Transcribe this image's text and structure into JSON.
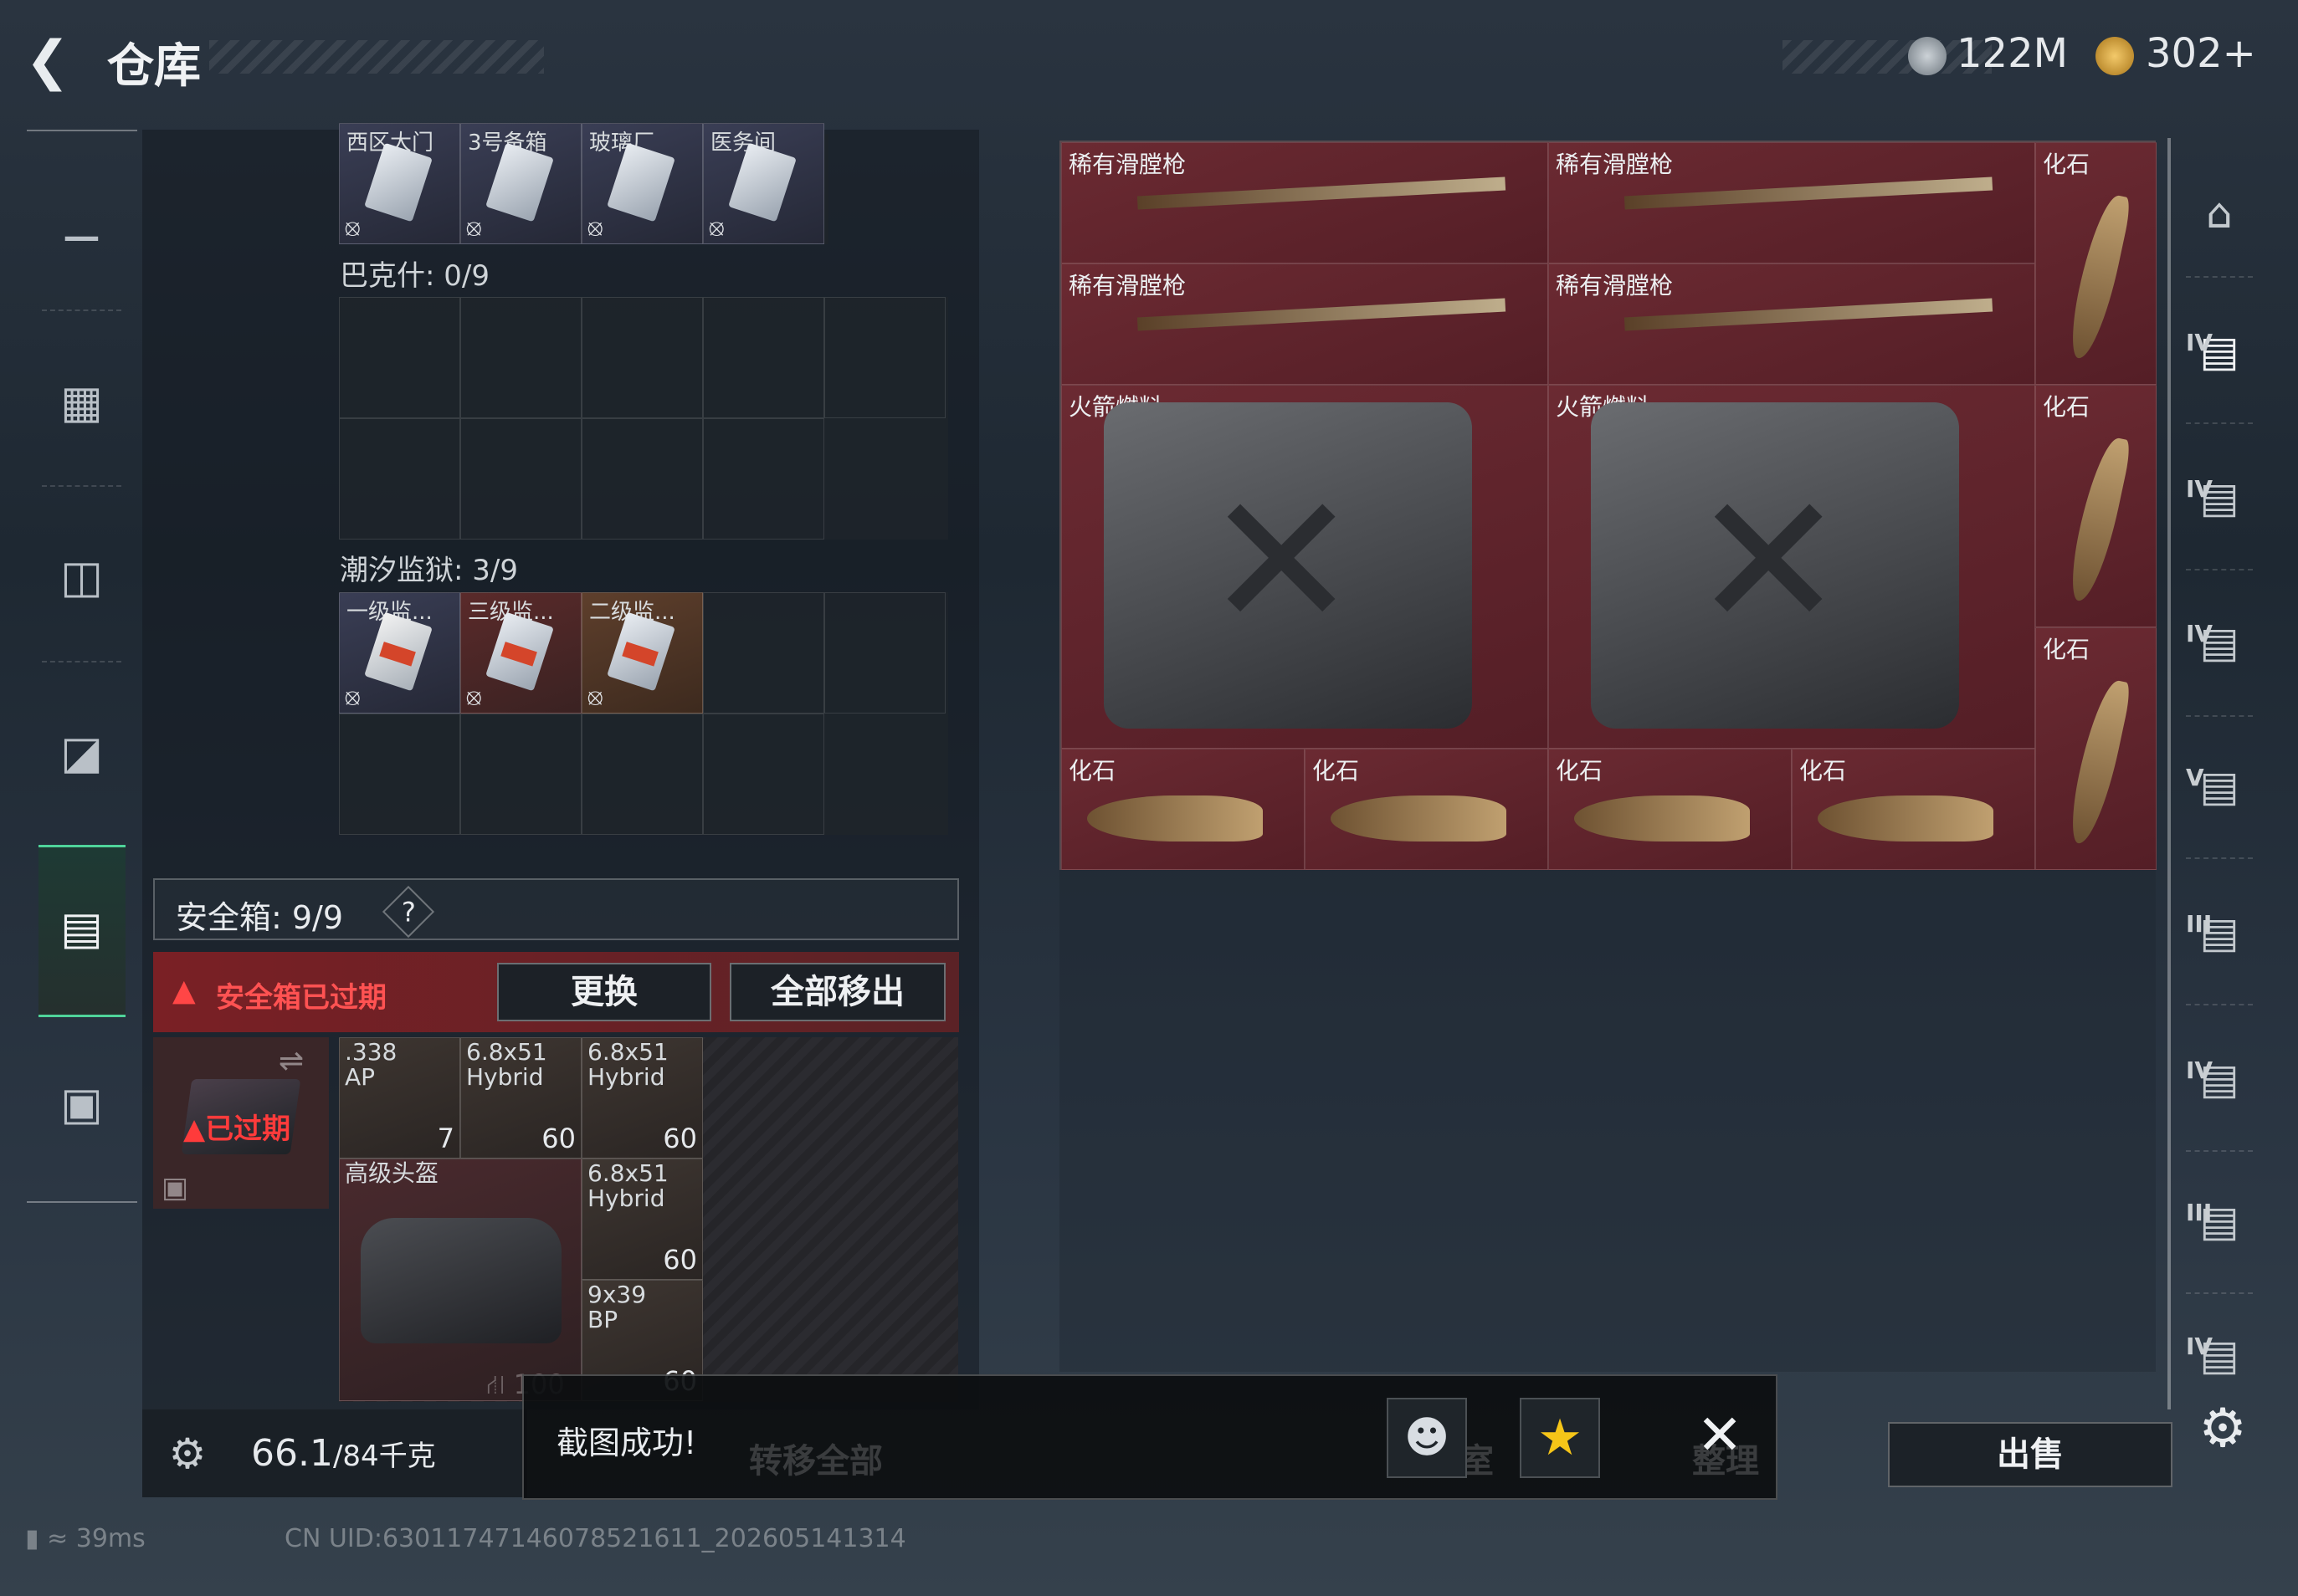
{
  "header": {
    "title": "仓库",
    "currency1": "122M",
    "currency2": "302+"
  },
  "left_nav": {
    "icons": [
      "gun-icon",
      "vest-icon",
      "backpack-icon",
      "bag-icon",
      "safe-box-icon",
      "briefcase-icon"
    ],
    "selected": "safe-box-icon"
  },
  "inventory": {
    "top_keys": [
      "西区大门",
      "3号备箱",
      "玻璃厂",
      "医务间"
    ],
    "section1": {
      "label": "巴克什: 0/9"
    },
    "section2": {
      "label": "潮汐监狱: 3/9",
      "items": [
        "一级监...",
        "三级监...",
        "二级监..."
      ]
    }
  },
  "safebox": {
    "label": "安全箱: 9/9",
    "help": "?",
    "expired_text": "安全箱已过期",
    "replace_label": "更换",
    "remove_all_label": "全部移出",
    "icon_expired": "已过期",
    "items": [
      {
        "name": ".338\nAP",
        "count": "7"
      },
      {
        "name": "6.8x51\nHybrid",
        "count": "60"
      },
      {
        "name": "6.8x51\nHybrid",
        "count": "60"
      },
      {
        "name": "高级头盔",
        "count": "100"
      },
      {
        "name": "6.8x51\nHybrid",
        "count": "60"
      },
      {
        "name": "9x39\nBP",
        "count": "60"
      }
    ]
  },
  "stash": {
    "items": [
      {
        "name": "稀有滑膛枪"
      },
      {
        "name": "稀有滑膛枪"
      },
      {
        "name": "化石"
      },
      {
        "name": "稀有滑膛枪"
      },
      {
        "name": "稀有滑膛枪"
      },
      {
        "name": "火箭燃料"
      },
      {
        "name": "火箭燃料"
      },
      {
        "name": "化石"
      },
      {
        "name": "化石"
      },
      {
        "name": "化石"
      },
      {
        "name": "化石"
      },
      {
        "name": "化石"
      },
      {
        "name": "化石"
      }
    ]
  },
  "right_nav": {
    "tiers": [
      "",
      "IV",
      "IV",
      "IV",
      "V",
      "III",
      "IV",
      "III",
      "IV"
    ]
  },
  "bottom": {
    "weight_value": "66.1",
    "weight_max": "/84千克",
    "transfer_all": "转移全部",
    "sell": "出售",
    "ghost1": "收藏室",
    "ghost2": "整理"
  },
  "toast": {
    "message": "截图成功!"
  },
  "status_bar": {
    "ping": "39ms",
    "uid": "CN UID:6301174714607852161​1_202605141314"
  },
  "colors": {
    "accent_green": "#4fd39a",
    "expired_red": "#ff4646",
    "stash_red": "#6b2a32"
  }
}
